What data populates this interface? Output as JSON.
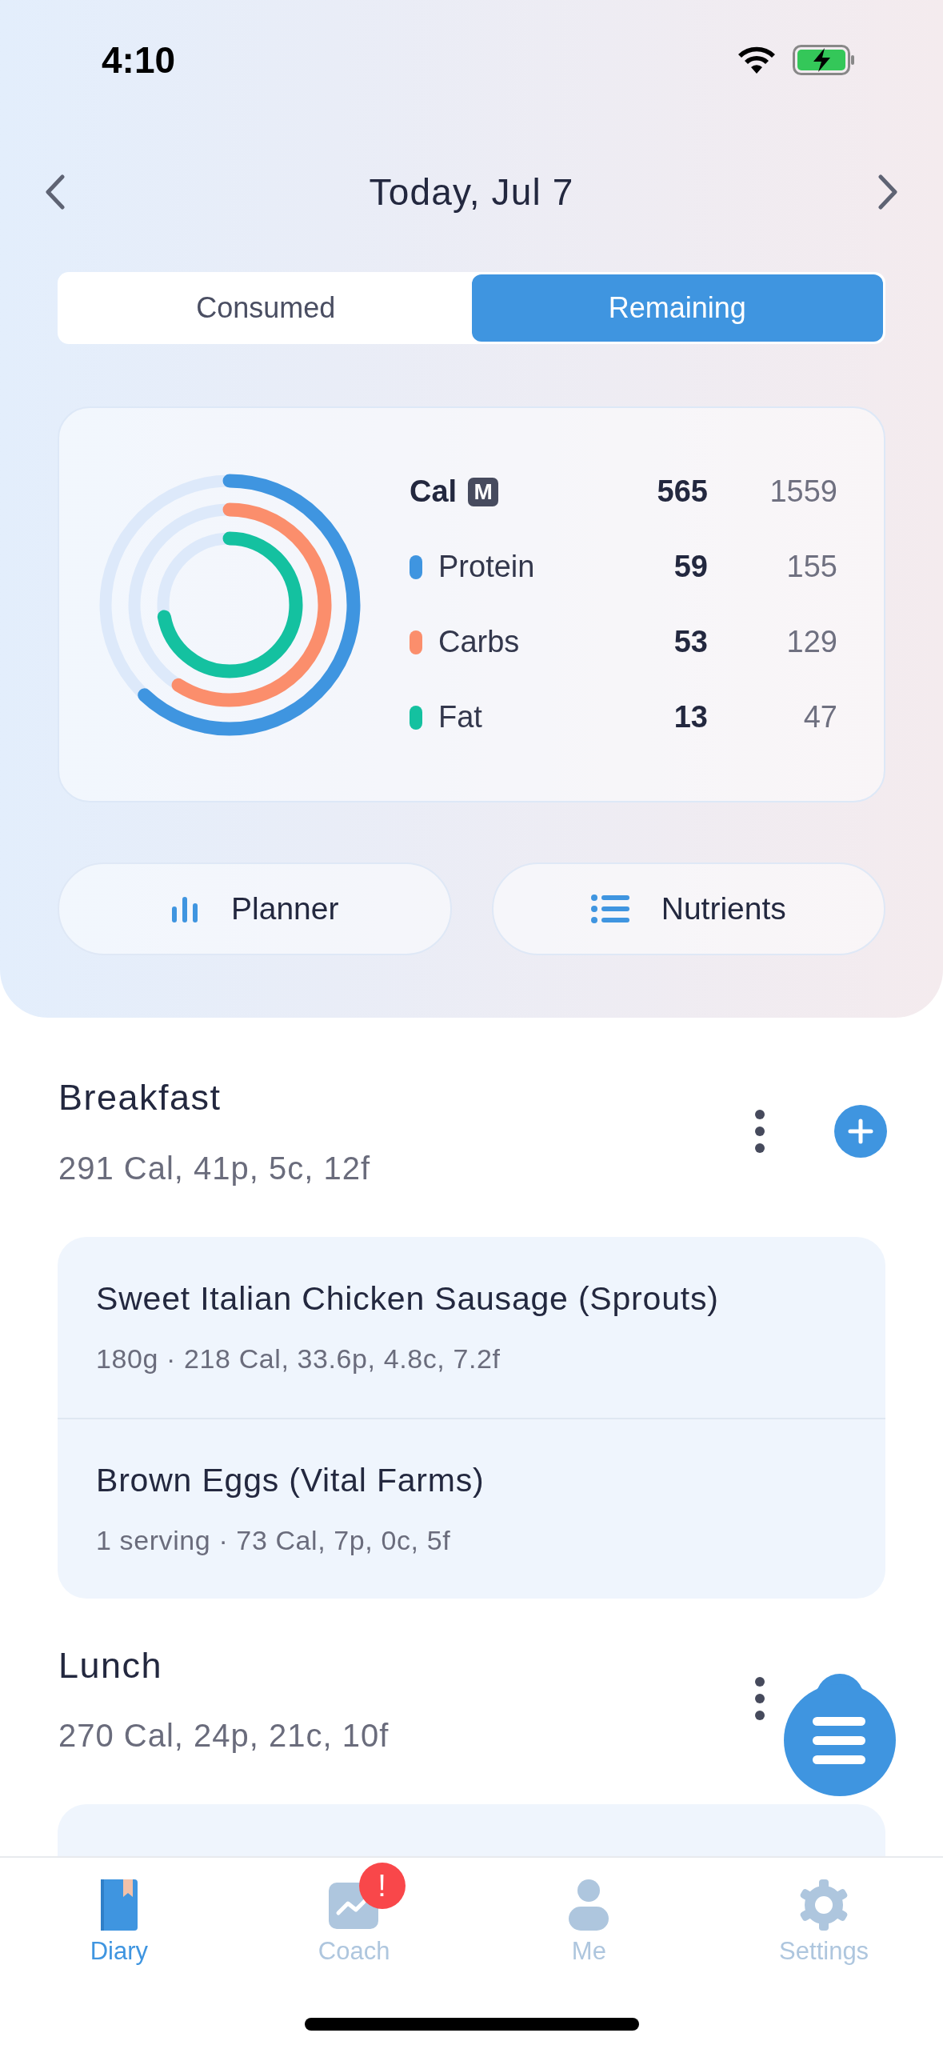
{
  "status_bar": {
    "time": "4:10"
  },
  "header": {
    "title": "Today, Jul 7"
  },
  "segments": [
    {
      "label": "Consumed",
      "selected": false
    },
    {
      "label": "Remaining",
      "selected": true
    }
  ],
  "summary": {
    "calories": {
      "label": "Cal",
      "badge": "M",
      "value": "565",
      "goal": "1559"
    },
    "rings": [
      {
        "color": "#3f95e0",
        "level": 0.62
      },
      {
        "color": "#fb8e6c",
        "level": 0.59
      },
      {
        "color": "#14c1a0",
        "level": 0.72
      }
    ],
    "macros": [
      {
        "label": "Protein",
        "value": "59",
        "goal": "155",
        "color": "#3f95e0"
      },
      {
        "label": "Carbs",
        "value": "53",
        "goal": "129",
        "color": "#fb8e6c"
      },
      {
        "label": "Fat",
        "value": "13",
        "goal": "47",
        "color": "#14c1a0"
      }
    ]
  },
  "actions": [
    {
      "kind": "chart",
      "label": "Planner"
    },
    {
      "kind": "list",
      "label": "Nutrients"
    }
  ],
  "meals": [
    {
      "title": "Breakfast",
      "summary": "291 Cal, 41p, 5c, 12f",
      "add_button": true,
      "foods": [
        {
          "name": "Sweet Italian Chicken Sausage (Sprouts)",
          "detail": "180g · 218 Cal, 33.6p, 4.8c, 7.2f"
        },
        {
          "name": "Brown Eggs (Vital Farms)",
          "detail": "1 serving · 73 Cal, 7p, 0c, 5f"
        }
      ]
    },
    {
      "title": "Lunch",
      "summary": "270 Cal, 24p, 21c, 10f",
      "add_button": false
    }
  ],
  "tab_bar": [
    {
      "kind": "diary",
      "label": "Diary",
      "selected": true
    },
    {
      "kind": "coach",
      "label": "Coach",
      "selected": false,
      "badge": "!"
    },
    {
      "kind": "me",
      "label": "Me",
      "selected": false
    },
    {
      "kind": "settings",
      "label": "Settings",
      "selected": false
    }
  ]
}
